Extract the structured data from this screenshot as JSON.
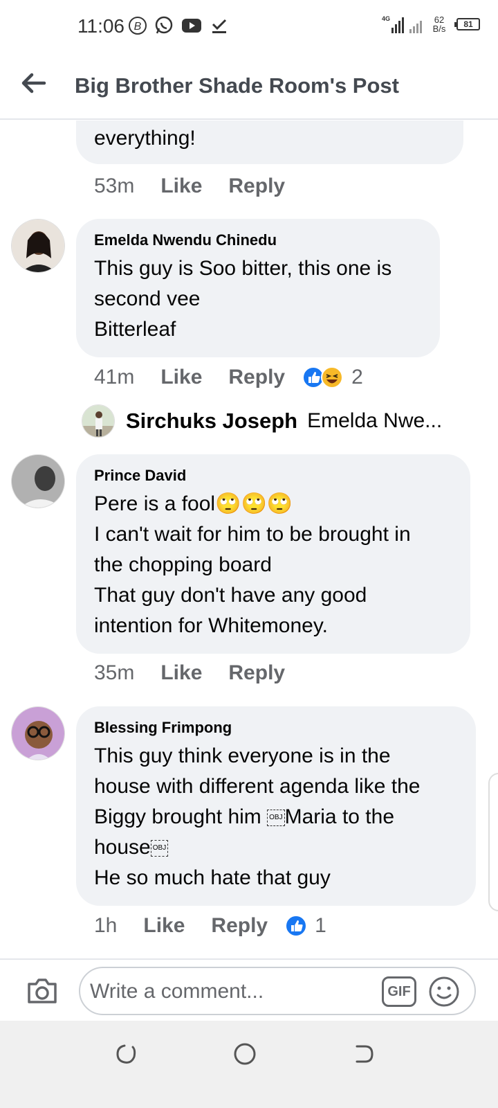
{
  "status_bar": {
    "time": "11:06",
    "network_label": "4G",
    "speed_value": "62",
    "speed_unit": "B/s",
    "battery": "81"
  },
  "header": {
    "title": "Big Brother Shade Room's Post"
  },
  "comments": [
    {
      "text": "everything!",
      "time": "53m",
      "like": "Like",
      "reply": "Reply"
    },
    {
      "author": "Emelda Nwendu Chinedu",
      "text": "This guy is Soo bitter, this one is\nsecond vee\nBitterleaf",
      "time": "41m",
      "like": "Like",
      "reply": "Reply",
      "reaction_count": "2",
      "reactions": [
        "like-icon",
        "haha-icon"
      ]
    },
    {
      "author": "Prince David",
      "text_line1": "Pere is a fool",
      "text_rest": "I can't wait for him to be brought  in\nthe chopping board\nThat guy don't have any good\nintention for Whitemoney.",
      "emojis": "🙄🙄🙄",
      "time": "35m",
      "like": "Like",
      "reply": "Reply"
    },
    {
      "author": "Blessing Frimpong",
      "line1": "This guy think everyone is in the",
      "line2": "house with different agenda like the",
      "line3a": "Biggy brought him ",
      "line3b": "Maria to the",
      "line4": "house",
      "line5": "He so much hate that guy",
      "obj_label": "OBJ",
      "time": "1h",
      "like": "Like",
      "reply": "Reply",
      "reaction_count": "1",
      "reactions": [
        "like-icon"
      ]
    }
  ],
  "reply_preview": {
    "name": "Sirchuks Joseph",
    "text": "Emelda Nwe..."
  },
  "composer": {
    "placeholder": "Write a comment...",
    "gif_label": "GIF"
  },
  "colors": {
    "bubble": "#f0f2f5",
    "like_blue": "#1877f2",
    "haha_yellow": "#f7b928",
    "secondary_text": "#65676b"
  }
}
